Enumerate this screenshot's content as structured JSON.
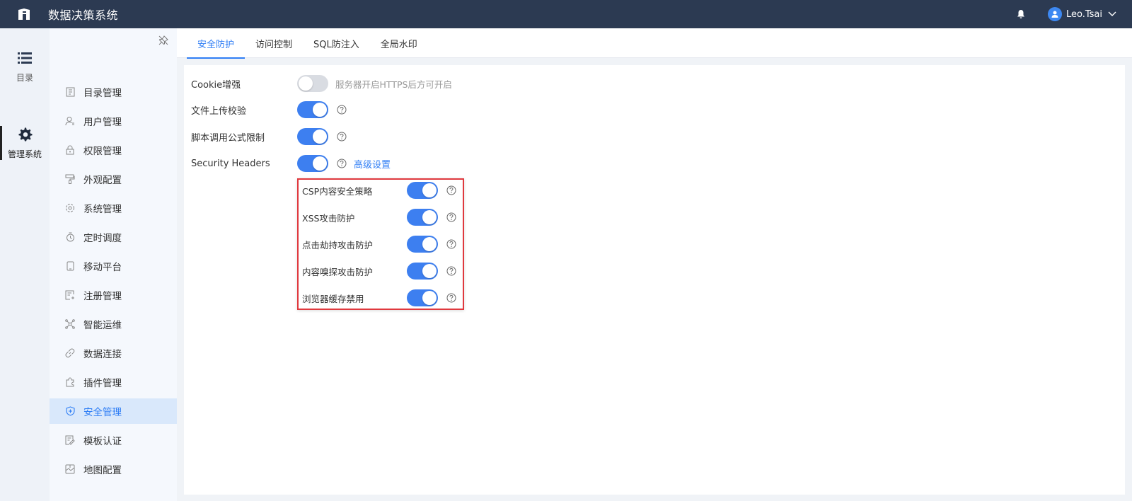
{
  "app": {
    "title": "数据决策系统"
  },
  "user": {
    "name": "Leo.Tsai"
  },
  "rail": [
    {
      "label": "目录",
      "icon": "list-icon"
    },
    {
      "label": "管理系统",
      "icon": "gear-icon"
    }
  ],
  "menu": [
    {
      "label": "目录管理",
      "icon": "catalog-icon"
    },
    {
      "label": "用户管理",
      "icon": "user-icon"
    },
    {
      "label": "权限管理",
      "icon": "lock-icon"
    },
    {
      "label": "外观配置",
      "icon": "brush-icon"
    },
    {
      "label": "系统管理",
      "icon": "settings-icon"
    },
    {
      "label": "定时调度",
      "icon": "timer-icon"
    },
    {
      "label": "移动平台",
      "icon": "mobile-icon"
    },
    {
      "label": "注册管理",
      "icon": "register-icon"
    },
    {
      "label": "智能运维",
      "icon": "network-icon"
    },
    {
      "label": "数据连接",
      "icon": "link-icon"
    },
    {
      "label": "插件管理",
      "icon": "puzzle-icon"
    },
    {
      "label": "安全管理",
      "icon": "shield-icon"
    },
    {
      "label": "模板认证",
      "icon": "template-icon"
    },
    {
      "label": "地图配置",
      "icon": "map-icon"
    }
  ],
  "tabs": [
    {
      "label": "安全防护"
    },
    {
      "label": "访问控制"
    },
    {
      "label": "SQL防注入"
    },
    {
      "label": "全局水印"
    }
  ],
  "settings": {
    "cookie": {
      "label": "Cookie增强",
      "on": false,
      "hint": "服务器开启HTTPS后方可开启"
    },
    "upload": {
      "label": "文件上传校验",
      "on": true
    },
    "script": {
      "label": "脚本调用公式限制",
      "on": true
    },
    "headers": {
      "label": "Security Headers",
      "on": true,
      "link": "高级设置"
    }
  },
  "security_headers": [
    {
      "label": "CSP内容安全策略",
      "on": true
    },
    {
      "label": "XSS攻击防护",
      "on": true
    },
    {
      "label": "点击劫持攻击防护",
      "on": true
    },
    {
      "label": "内容嗅探攻击防护",
      "on": true
    },
    {
      "label": "浏览器缓存禁用",
      "on": true
    }
  ],
  "colors": {
    "topbar": "#2c3a52",
    "accent": "#2f7ef5",
    "highlight_border": "#e0393e"
  }
}
